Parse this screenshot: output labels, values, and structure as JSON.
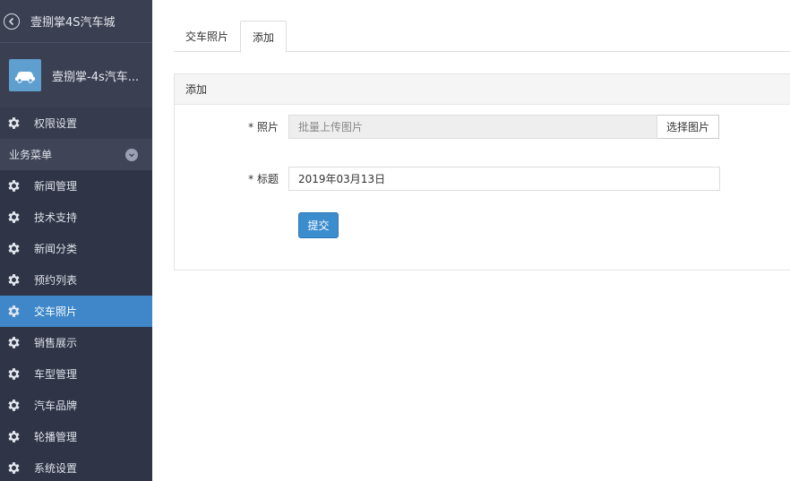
{
  "sidebar": {
    "header_title": "壹捌掌4S汽车城",
    "profile_name": "壹捌掌-4s汽车...",
    "top_item": "权限设置",
    "section_label": "业务菜单",
    "items": [
      {
        "label": "新闻管理"
      },
      {
        "label": "技术支持"
      },
      {
        "label": "新闻分类"
      },
      {
        "label": "预约列表"
      },
      {
        "label": "交车照片"
      },
      {
        "label": "销售展示"
      },
      {
        "label": "车型管理"
      },
      {
        "label": "汽车品牌"
      },
      {
        "label": "轮播管理"
      },
      {
        "label": "系统设置"
      }
    ],
    "active_index": 4
  },
  "tabs": [
    {
      "label": "交车照片"
    },
    {
      "label": "添加"
    }
  ],
  "panel": {
    "title": "添加",
    "photo_label": "* 照片",
    "photo_placeholder": "批量上传图片",
    "photo_button": "选择图片",
    "title_label": "* 标题",
    "title_value": "2019年03月13日",
    "submit_label": "提交"
  },
  "colors": {
    "sidebar_bg": "#3a3f51",
    "active_item": "#3f87c9",
    "primary_button": "#3c8dce"
  }
}
